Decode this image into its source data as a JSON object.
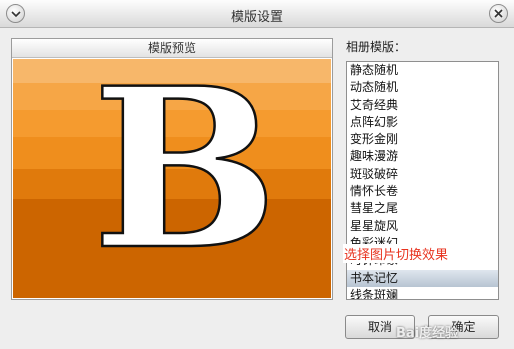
{
  "window": {
    "title": "模版设置"
  },
  "preview": {
    "header": "模版预览",
    "letter": "B",
    "colors": [
      "#f7b76a",
      "#f6a646",
      "#f59b2f",
      "#ef8e1d",
      "#e07a0c",
      "#cc6500"
    ]
  },
  "list": {
    "label": "相册模版：",
    "items": [
      "静态随机",
      "动态随机",
      "艾奇经典",
      "点阵幻影",
      "变形金刚",
      "趣味漫游",
      "斑驳破碎",
      "情怀长卷",
      "彗星之尾",
      "星星旋风",
      "色彩迷幻",
      "时钟印象",
      "书本记忆",
      "线条斑斓"
    ],
    "selected": "书本记忆"
  },
  "annotation": "选择图片切换效果",
  "buttons": {
    "cancel": "取消",
    "ok": "确定"
  },
  "watermark": "Bai度经验"
}
